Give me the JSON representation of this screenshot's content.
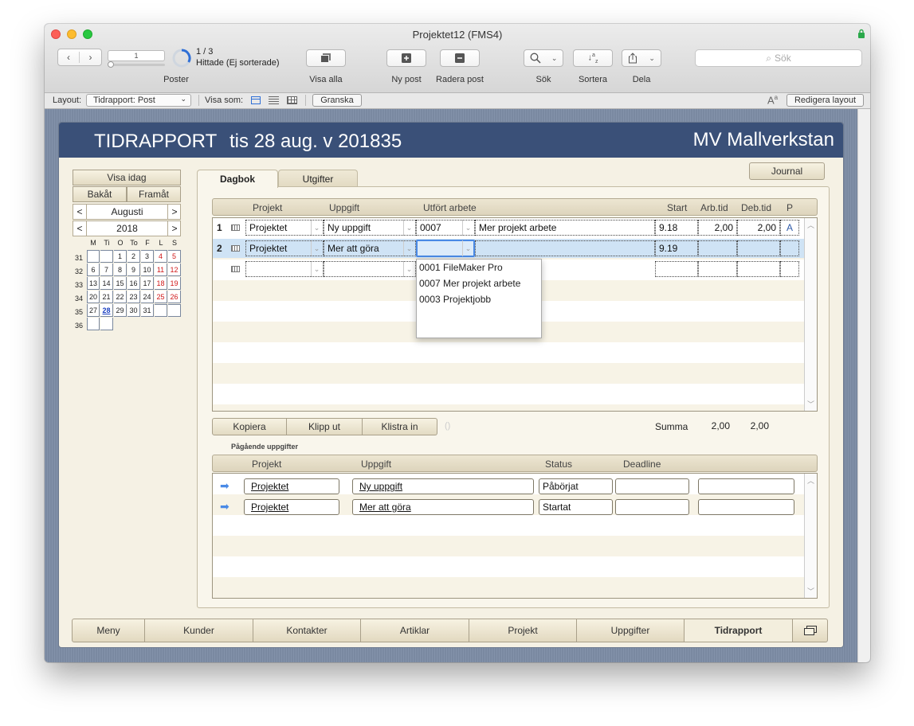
{
  "window": {
    "title": "Projektet12 (FMS4)"
  },
  "toolbar": {
    "record_number": "1",
    "found": "1 / 3",
    "found_note": "Hittade (Ej sorterade)",
    "records_label": "Poster",
    "show_all": "Visa alla",
    "new_record": "Ny post",
    "delete_record": "Radera post",
    "search": "Sök",
    "sort": "Sortera",
    "share": "Dela",
    "search_placeholder": "Sök"
  },
  "layoutbar": {
    "layout_label": "Layout:",
    "layout_value": "Tidrapport: Post",
    "view_as": "Visa som:",
    "preview": "Granska",
    "edit_layout": "Redigera layout"
  },
  "header": {
    "title": "TIDRAPPORT",
    "date": "tis 28 aug. v 201835",
    "company": "MV Mallverkstan"
  },
  "calendar": {
    "today": "Visa idag",
    "back": "Bakåt",
    "forward": "Framåt",
    "month": "Augusti",
    "year": "2018",
    "prev": "<",
    "next": ">",
    "weekday_headers": [
      "M",
      "Ti",
      "O",
      "To",
      "F",
      "L",
      "S"
    ],
    "week_numbers": [
      "31",
      "32",
      "33",
      "34",
      "35",
      "36"
    ],
    "weeks": [
      [
        "",
        "",
        "1",
        "2",
        "3",
        "4",
        "5"
      ],
      [
        "6",
        "7",
        "8",
        "9",
        "10",
        "11",
        "12"
      ],
      [
        "13",
        "14",
        "15",
        "16",
        "17",
        "18",
        "19"
      ],
      [
        "20",
        "21",
        "22",
        "23",
        "24",
        "25",
        "26"
      ],
      [
        "27",
        "28",
        "29",
        "30",
        "31",
        "",
        ""
      ],
      [
        "",
        "",
        "",
        "",
        "",
        "",
        ""
      ]
    ],
    "today_day": "28"
  },
  "tabs": {
    "diary": "Dagbok",
    "expenses": "Utgifter",
    "journal": "Journal"
  },
  "diary": {
    "columns": {
      "project": "Projekt",
      "task": "Uppgift",
      "work": "Utfört arbete",
      "start": "Start",
      "work_time": "Arb.tid",
      "debit_time": "Deb.tid",
      "p": "P"
    },
    "rows": [
      {
        "num": "1",
        "project": "Projektet",
        "task": "Ny uppgift",
        "code": "0007",
        "work": "Mer projekt arbete",
        "start": "9.18",
        "work_time": "2,00",
        "debit_time": "2,00",
        "p": "A"
      },
      {
        "num": "2",
        "project": "Projektet",
        "task": "Mer att göra",
        "code": "",
        "work": "",
        "start": "9.19",
        "work_time": "",
        "debit_time": "",
        "p": ""
      }
    ],
    "dropdown": [
      "0001 FileMaker Pro",
      "0007 Mer projekt arbete",
      "0003 Projektjobb"
    ],
    "copy": "Kopiera",
    "cut": "Klipp ut",
    "paste": "Klistra in",
    "paste_count": "()",
    "sum_label": "Summa",
    "sum_work": "2,00",
    "sum_debit": "2,00"
  },
  "ongoing": {
    "heading": "Pågående uppgifter",
    "columns": {
      "project": "Projekt",
      "task": "Uppgift",
      "status": "Status",
      "deadline": "Deadline"
    },
    "rows": [
      {
        "project": "Projektet",
        "task": "Ny uppgift",
        "status": "Påbörjat",
        "deadline": "",
        "extra": ""
      },
      {
        "project": "Projektet",
        "task": "Mer att göra",
        "status": "Startat",
        "deadline": "",
        "extra": ""
      }
    ]
  },
  "nav": [
    "Meny",
    "Kunder",
    "Kontakter",
    "Artiklar",
    "Projekt",
    "Uppgifter",
    "Tidrapport"
  ],
  "nav_active": "Tidrapport",
  "colors": {
    "header": "#3a5078",
    "selected_row": "#cfe3f5",
    "accent_blue": "#2f6fd6"
  }
}
